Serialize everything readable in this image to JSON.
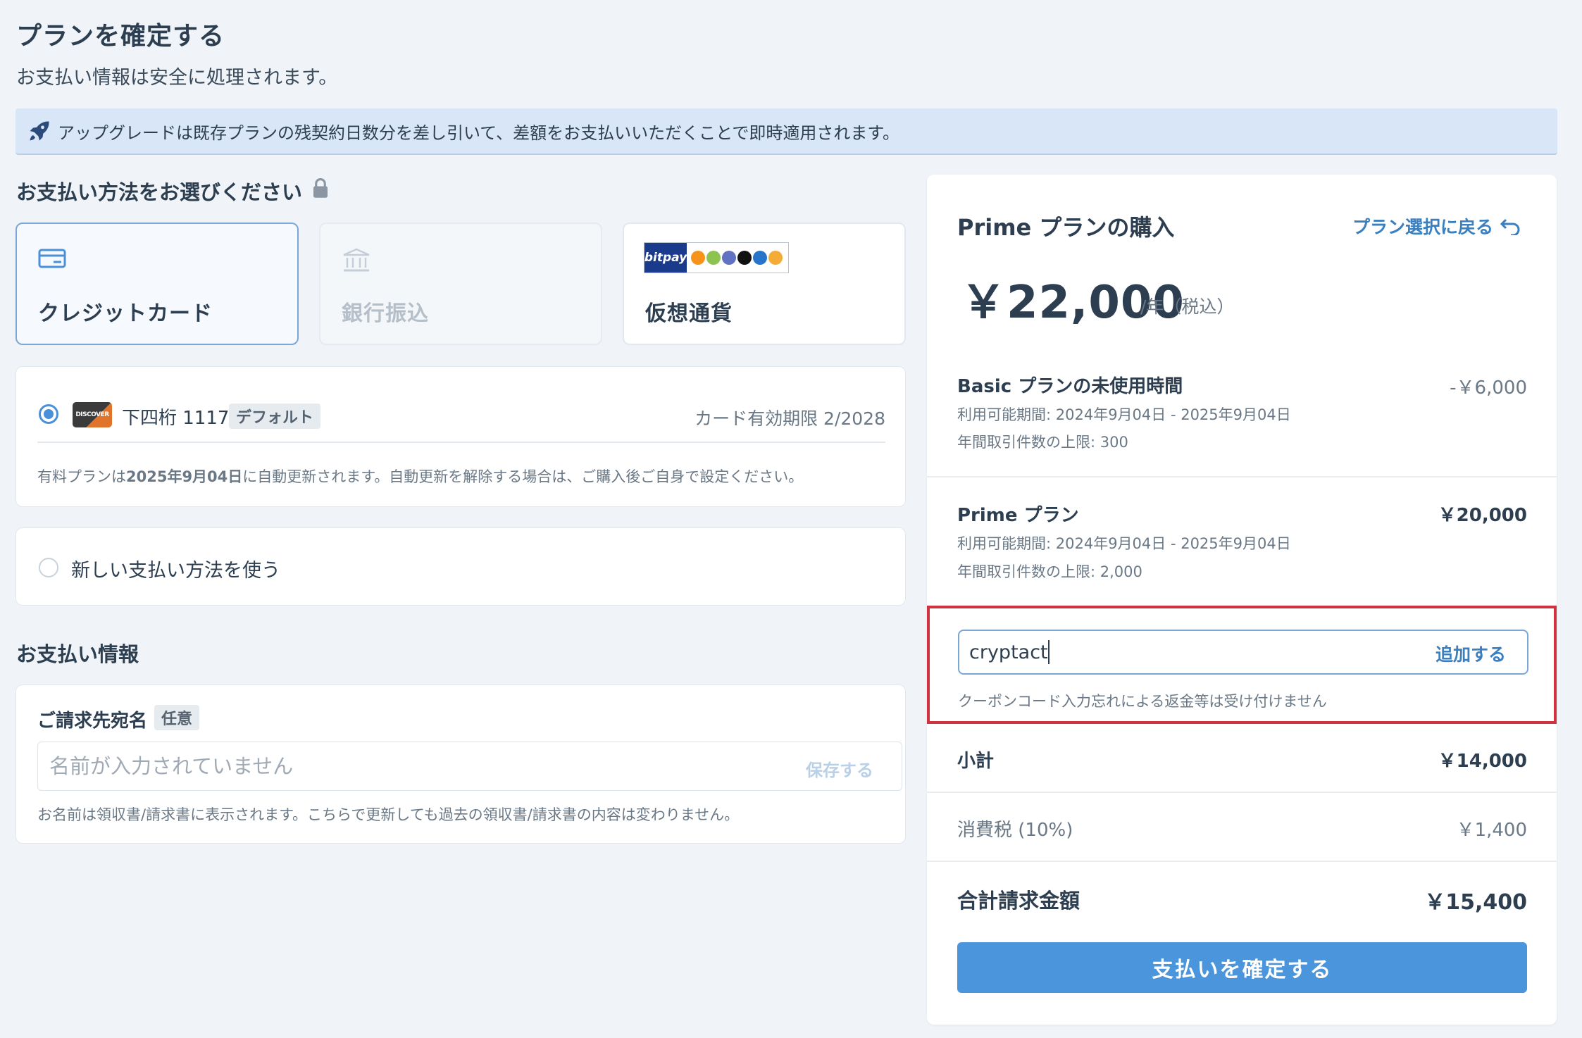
{
  "page": {
    "title": "プランを確定する",
    "subtitle": "お支払い情報は安全に処理されます。"
  },
  "notice": {
    "text": "アップグレードは既存プランの残契約日数分を差し引いて、差額をお支払いいただくことで即時適用されます。"
  },
  "payment_method": {
    "heading": "お支払い方法をお選びください",
    "options": [
      {
        "label": "クレジットカード",
        "icon": "credit-card-icon",
        "state": "selected"
      },
      {
        "label": "銀行振込",
        "icon": "bank-icon",
        "state": "disabled"
      },
      {
        "label": "仮想通貨",
        "icon": "bitpay-crypto-logo",
        "logo_text": "bitpay",
        "state": "available"
      }
    ]
  },
  "saved_card": {
    "brand": "DISCOVER",
    "last_four_label": "下四桁 1117",
    "default_tag": "デフォルト",
    "expiry": "カード有効期限 2/2028",
    "renewal_note_prefix": "有料プランは",
    "renewal_date": "2025年9月04日",
    "renewal_note_suffix": "に自動更新されます。自動更新を解除する場合は、ご購入後ご自身で設定ください。",
    "selected": true
  },
  "new_method": {
    "label": "新しい支払い方法を使う",
    "selected": false
  },
  "billing": {
    "heading": "お支払い情報",
    "name_label": "ご請求先宛名",
    "optional_tag": "任意",
    "name_placeholder": "名前が入力されていません",
    "name_value": "",
    "save_label": "保存する",
    "note": "お名前は領収書/請求書に表示されます。こちらで更新しても過去の領収書/請求書の内容は変わりません。"
  },
  "summary": {
    "title": "Prime プランの購入",
    "back_label": "プラン選択に戻る",
    "price": "￥22,000",
    "price_unit": "/年（税込）",
    "lines": [
      {
        "title": "Basic プランの未使用時間",
        "amount": "-￥6,000",
        "period": "利用可能期間: 2024年9月04日 - 2025年9月04日",
        "limit": "年間取引件数の上限: 300"
      },
      {
        "title": "Prime プラン",
        "amount": "￥20,000",
        "period": "利用可能期間: 2024年9月04日 - 2025年9月04日",
        "limit": "年間取引件数の上限: 2,000"
      }
    ],
    "coupon": {
      "value": "cryptact",
      "add_label": "追加する",
      "note": "クーポンコード入力忘れによる返金等は受け付けません"
    },
    "subtotal_label": "小計",
    "subtotal": "￥14,000",
    "tax_label": "消費税 (10%)",
    "tax": "￥1,400",
    "total_label": "合計請求金額",
    "total": "￥15,400",
    "confirm_label": "支払いを確定する"
  },
  "colors": {
    "accent": "#4a95db",
    "link": "#3a7fbf",
    "highlight_border": "#d0323f",
    "notice_bg": "#d8e6f7",
    "page_bg": "#f0f4f8"
  }
}
